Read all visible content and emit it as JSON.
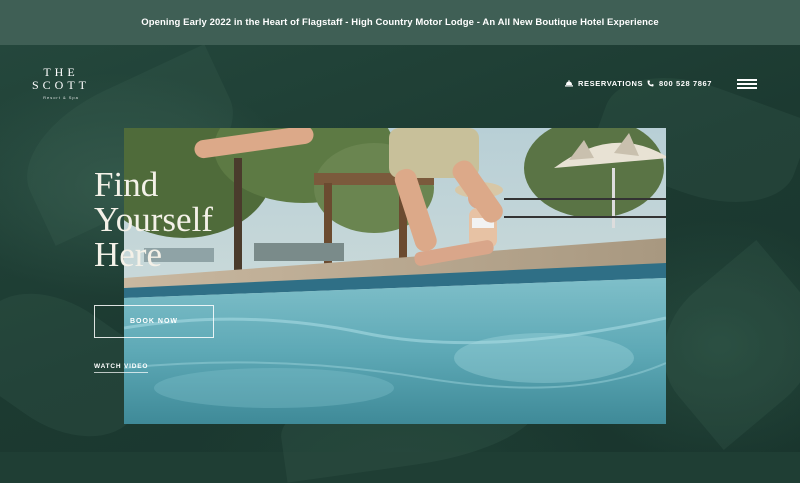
{
  "announcement": "Opening Early 2022 in the Heart of Flagstaff - High Country Motor Lodge - An All New Boutique Hotel Experience",
  "logo": {
    "line1": "THE",
    "line2": "SCOTT",
    "tagline": "Resort & Spa"
  },
  "nav": {
    "reservations": {
      "icon": "bell-icon",
      "label": "RESERVATIONS"
    },
    "phone": {
      "icon": "phone-icon",
      "label": "800 528 7867"
    },
    "menu_icon": "hamburger-icon"
  },
  "hero": {
    "headline": [
      "Find",
      "Yourself",
      "Here"
    ],
    "book_button": "BOOK NOW",
    "watch_video": "WATCH VIDEO"
  },
  "colors": {
    "announcement_bg": "#3f5f55",
    "hero_bg": "#1f3e34",
    "text": "#ffffff",
    "pool_water": "#6fb7c4"
  }
}
